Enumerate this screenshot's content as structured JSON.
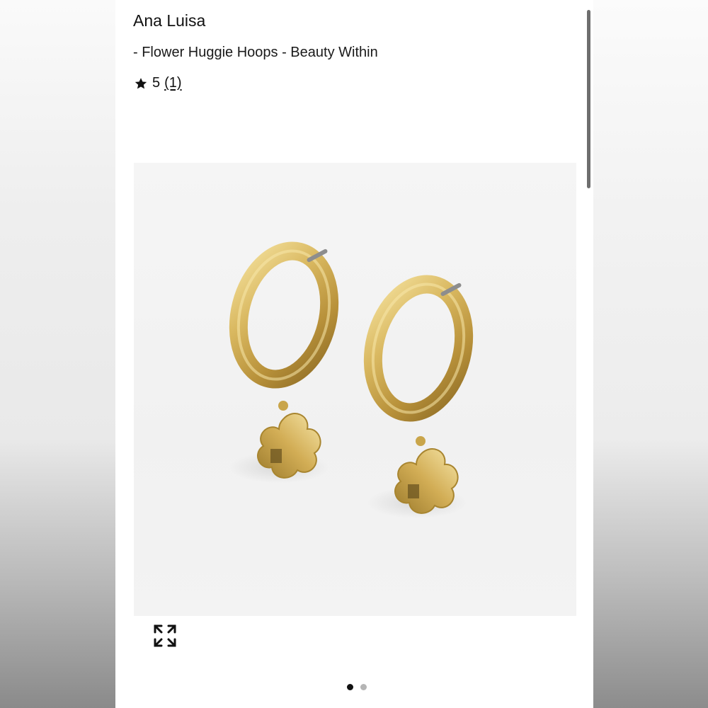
{
  "product": {
    "brand": "Ana Luisa",
    "title": "- Flower Huggie Hoops - Beauty Within",
    "rating": {
      "value": "5",
      "count_text": "(1)",
      "stars": 5,
      "icon": "star-icon"
    },
    "image": {
      "alt": "Gold flower huggie hoop earrings",
      "current_slide": 1,
      "total_slides": 2
    }
  },
  "controls": {
    "expand_icon": "expand-icon"
  },
  "colors": {
    "gold": "#d4b45a",
    "text": "#111111",
    "dot_active": "#111111",
    "dot_inactive": "#b5b5b5"
  }
}
